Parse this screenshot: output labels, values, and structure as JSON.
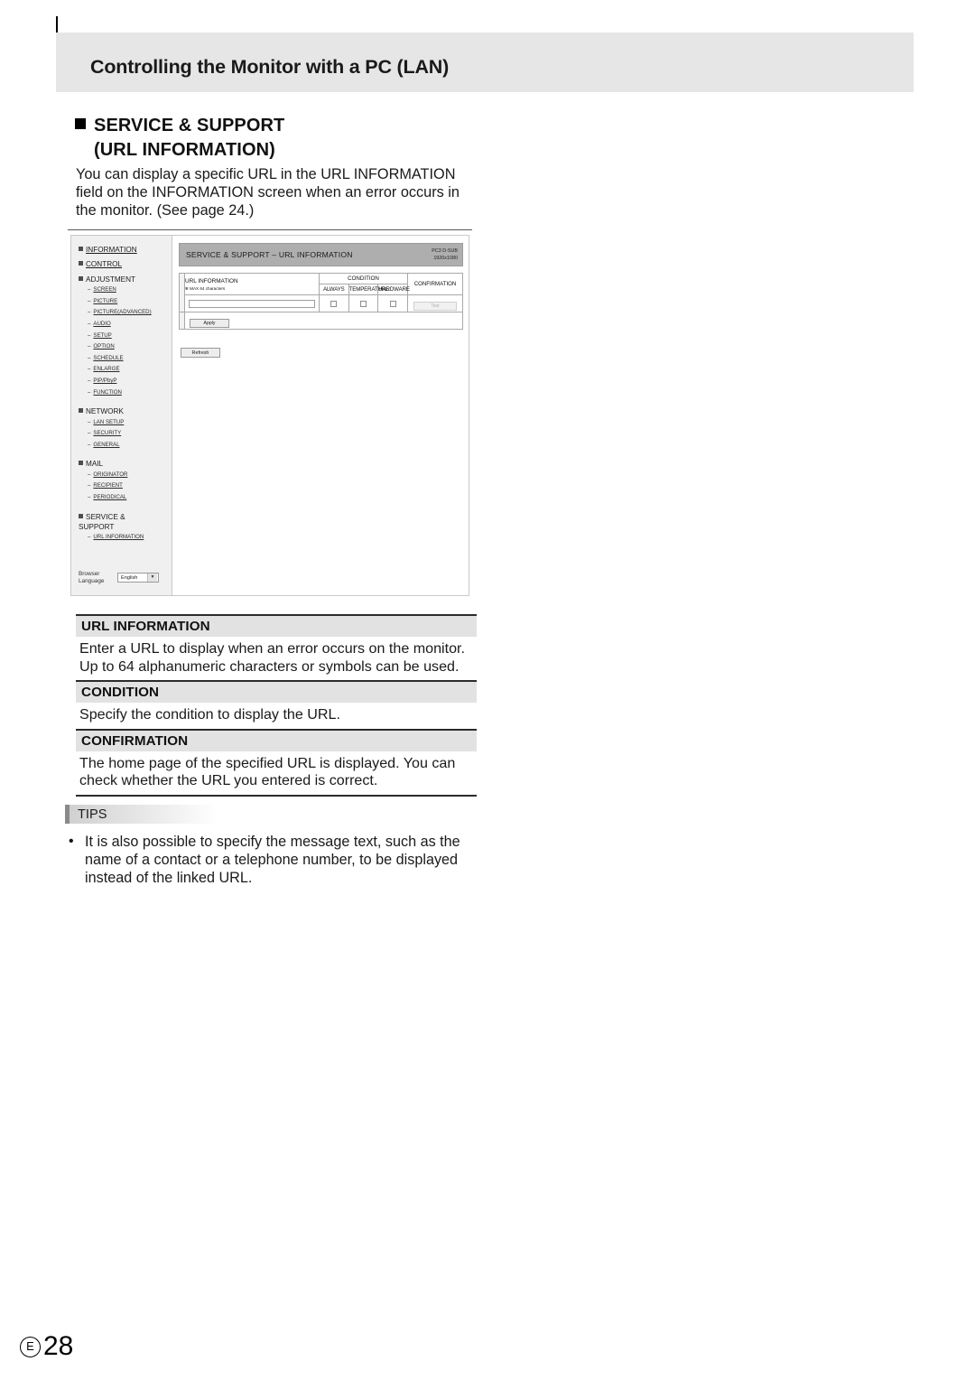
{
  "chapter": {
    "title": "Controlling the Monitor with a PC (LAN)"
  },
  "section": {
    "line1": "SERVICE & SUPPORT",
    "line2": "(URL INFORMATION)",
    "intro": "You can display a specific URL in the URL INFORMATION field on the INFORMATION screen when an error occurs in the monitor. (See page 24.)"
  },
  "screenshot": {
    "sidebar": {
      "groups": [
        {
          "label": "INFORMATION",
          "children": []
        },
        {
          "label": "CONTROL",
          "children": []
        },
        {
          "label": "ADJUSTMENT",
          "children": [
            "SCREEN",
            "PICTURE",
            "PICTURE(ADVANCED)",
            "AUDIO",
            "SETUP",
            "OPTION",
            "SCHEDULE",
            "ENLARGE",
            "PIP/PbyP",
            "FUNCTION"
          ]
        },
        {
          "label": "NETWORK",
          "children": [
            "LAN SETUP",
            "SECURITY",
            "GENERAL"
          ]
        },
        {
          "label": "MAIL",
          "children": [
            "ORIGINATOR",
            "RECIPIENT",
            "PERIODICAL"
          ]
        },
        {
          "label": "SERVICE &",
          "label2": "SUPPORT",
          "children": [
            "URL INFORMATION"
          ]
        }
      ],
      "browser_language": {
        "label_line1": "Browser",
        "label_line2": "Language",
        "selected": "English",
        "caret": "▼"
      }
    },
    "panel": {
      "title": "SERVICE & SUPPORT – URL INFORMATION",
      "source": "PC3 D-SUB",
      "resolution": "1920x1080"
    },
    "table": {
      "col_url_title": "URL INFORMATION",
      "col_url_note": "✻ MAX 64 characters",
      "col_condition": "CONDITION",
      "col_confirmation": "CONFIRMATION",
      "sub_headers": [
        "ALWAYS",
        "TEMPERATURE",
        "HARDWARE"
      ],
      "url_value": "",
      "checkboxes": [
        false,
        false,
        false
      ],
      "test_button": "Test",
      "apply_button": "Apply"
    },
    "refresh_button": "Refresh"
  },
  "definitions": [
    {
      "term": "URL INFORMATION",
      "desc": "Enter a URL to display when an error occurs on the monitor. Up to 64 alphanumeric characters or symbols can be used."
    },
    {
      "term": "CONDITION",
      "desc": "Specify the condition to display the URL."
    },
    {
      "term": "CONFIRMATION",
      "desc": "The home page of the specified URL is displayed. You can check whether the URL you entered is correct."
    }
  ],
  "tips": {
    "label": "TIPS",
    "bullet": "•",
    "items": [
      "It is also possible to specify the message text, such as the name of a contact or a telephone number, to be displayed instead of the linked URL."
    ]
  },
  "footer": {
    "mark": "E",
    "page": "28"
  }
}
